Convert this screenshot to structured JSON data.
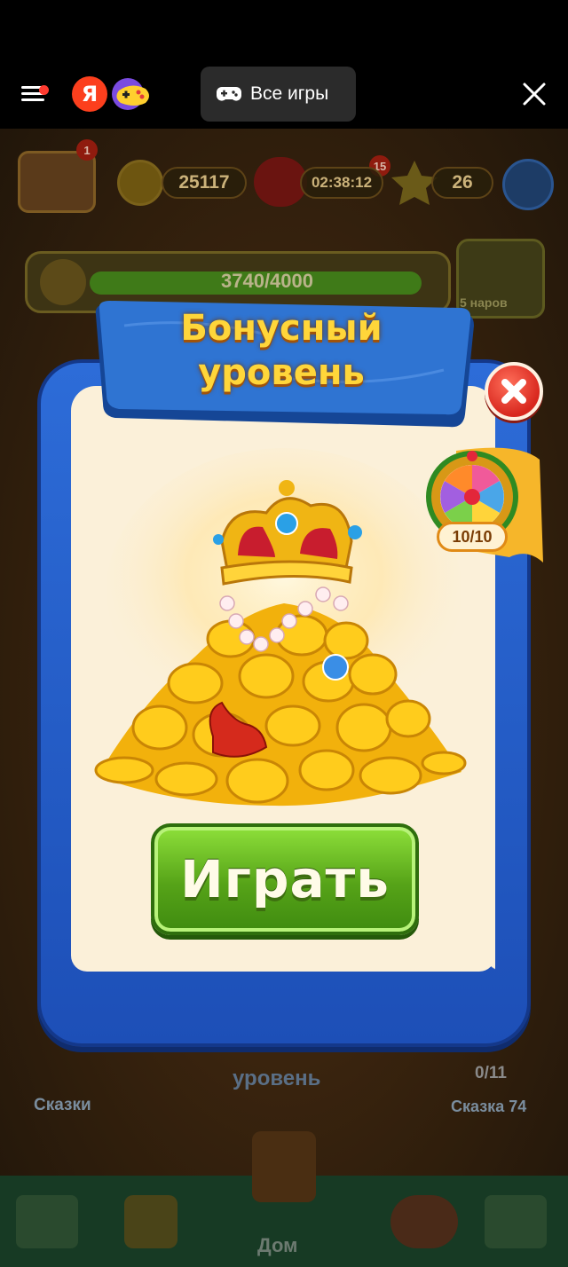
{
  "topbar": {
    "brand_letter": "Я",
    "all_games_label": "Все игры"
  },
  "hud": {
    "coins": "25117",
    "timer": "02:38:12",
    "lives_badge": "15",
    "stars": "26",
    "profile_badge": "1",
    "progress_text": "3740/4000",
    "progress_fraction": 0.935,
    "side_label": "5 наров"
  },
  "background": {
    "left_label": "Сказки",
    "center_label": "уровень",
    "right_count": "0/11",
    "right_label": "Сказка 74",
    "nav_home": "Дом"
  },
  "popup": {
    "title_line1": "Бонусный",
    "title_line2": "уровень",
    "wheel_count": "10/10",
    "play_label": "Играть"
  },
  "colors": {
    "frame_blue": "#1d4fb7",
    "panel_cream": "#fbf0d9",
    "play_green": "#56a318",
    "title_yellow": "#ffd63a",
    "close_red": "#d8271e"
  }
}
